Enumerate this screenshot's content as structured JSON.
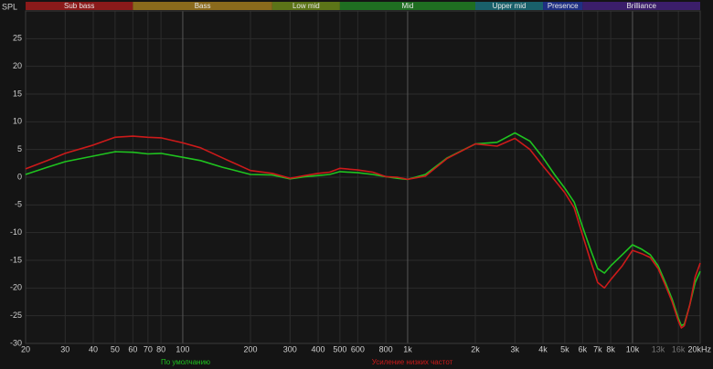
{
  "chart_data": {
    "type": "line",
    "y_axis_label": "SPL",
    "x_scale": "log",
    "x_range": [
      20,
      20000
    ],
    "y_range": [
      -30,
      30
    ],
    "grid": true,
    "bands": [
      {
        "label": "Sub bass",
        "from": 20,
        "to": 60,
        "color": "#8b1a1a"
      },
      {
        "label": "Bass",
        "from": 60,
        "to": 250,
        "color": "#8a6a1c"
      },
      {
        "label": "Low mid",
        "from": 250,
        "to": 500,
        "color": "#5c7418"
      },
      {
        "label": "Mid",
        "from": 500,
        "to": 2000,
        "color": "#1f6e21"
      },
      {
        "label": "Upper mid",
        "from": 2000,
        "to": 4000,
        "color": "#19606a"
      },
      {
        "label": "Presence",
        "from": 4000,
        "to": 6000,
        "color": "#1f2f82"
      },
      {
        "label": "Brilliance",
        "from": 6000,
        "to": 20000,
        "color": "#3b1e6a"
      }
    ],
    "x_ticks": [
      {
        "value": 20,
        "label": "20"
      },
      {
        "value": 30,
        "label": "30"
      },
      {
        "value": 40,
        "label": "40"
      },
      {
        "value": 50,
        "label": "50"
      },
      {
        "value": 60,
        "label": "60"
      },
      {
        "value": 70,
        "label": "70"
      },
      {
        "value": 80,
        "label": "80"
      },
      {
        "value": 100,
        "label": "100"
      },
      {
        "value": 200,
        "label": "200"
      },
      {
        "value": 300,
        "label": "300"
      },
      {
        "value": 400,
        "label": "400"
      },
      {
        "value": 500,
        "label": "500"
      },
      {
        "value": 600,
        "label": "600"
      },
      {
        "value": 800,
        "label": "800"
      },
      {
        "value": 1000,
        "label": "1k"
      },
      {
        "value": 2000,
        "label": "2k"
      },
      {
        "value": 3000,
        "label": "3k"
      },
      {
        "value": 4000,
        "label": "4k"
      },
      {
        "value": 5000,
        "label": "5k"
      },
      {
        "value": 6000,
        "label": "6k"
      },
      {
        "value": 7000,
        "label": "7k"
      },
      {
        "value": 8000,
        "label": "8k"
      },
      {
        "value": 10000,
        "label": "10k"
      },
      {
        "value": 13000,
        "label": "13k"
      },
      {
        "value": 16000,
        "label": "16k"
      },
      {
        "value": 20000,
        "label": "20kHz"
      }
    ],
    "dim_tick_values": [
      13000,
      16000
    ],
    "major_gridlines": [
      100,
      1000,
      10000
    ],
    "y_ticks": [
      25,
      20,
      15,
      10,
      5,
      0,
      -5,
      -10,
      -15,
      -20,
      -25,
      -30
    ],
    "series": [
      {
        "name": "По умолчанию",
        "color": "#1fc31f",
        "points": [
          [
            20,
            0.5
          ],
          [
            25,
            1.8
          ],
          [
            30,
            2.8
          ],
          [
            40,
            3.8
          ],
          [
            50,
            4.6
          ],
          [
            60,
            4.5
          ],
          [
            70,
            4.2
          ],
          [
            80,
            4.3
          ],
          [
            100,
            3.6
          ],
          [
            120,
            3.0
          ],
          [
            150,
            1.8
          ],
          [
            200,
            0.5
          ],
          [
            250,
            0.4
          ],
          [
            300,
            -0.3
          ],
          [
            350,
            0.1
          ],
          [
            400,
            0.3
          ],
          [
            450,
            0.5
          ],
          [
            500,
            1.0
          ],
          [
            600,
            0.8
          ],
          [
            700,
            0.5
          ],
          [
            800,
            0.1
          ],
          [
            900,
            -0.2
          ],
          [
            1000,
            -0.4
          ],
          [
            1200,
            0.5
          ],
          [
            1500,
            3.5
          ],
          [
            2000,
            6.0
          ],
          [
            2500,
            6.3
          ],
          [
            3000,
            8.0
          ],
          [
            3500,
            6.5
          ],
          [
            4000,
            3.5
          ],
          [
            4500,
            0.5
          ],
          [
            5000,
            -2.0
          ],
          [
            5500,
            -4.5
          ],
          [
            6000,
            -9.0
          ],
          [
            6500,
            -13.0
          ],
          [
            7000,
            -16.5
          ],
          [
            7500,
            -17.3
          ],
          [
            8000,
            -16.0
          ],
          [
            9000,
            -14.0
          ],
          [
            10000,
            -12.2
          ],
          [
            11000,
            -13.0
          ],
          [
            12000,
            -14.0
          ],
          [
            13000,
            -16.0
          ],
          [
            14000,
            -19.0
          ],
          [
            15000,
            -22.0
          ],
          [
            16000,
            -25.5
          ],
          [
            16500,
            -26.8
          ],
          [
            17000,
            -26.5
          ],
          [
            18000,
            -23.0
          ],
          [
            19000,
            -19.0
          ],
          [
            20000,
            -17.0
          ]
        ]
      },
      {
        "name": "Усиление низких частот",
        "color": "#cc1a1a",
        "points": [
          [
            20,
            1.5
          ],
          [
            25,
            3.0
          ],
          [
            30,
            4.3
          ],
          [
            40,
            5.8
          ],
          [
            50,
            7.2
          ],
          [
            60,
            7.4
          ],
          [
            70,
            7.2
          ],
          [
            80,
            7.1
          ],
          [
            100,
            6.2
          ],
          [
            120,
            5.3
          ],
          [
            150,
            3.5
          ],
          [
            200,
            1.2
          ],
          [
            250,
            0.7
          ],
          [
            300,
            -0.2
          ],
          [
            350,
            0.3
          ],
          [
            400,
            0.7
          ],
          [
            450,
            0.9
          ],
          [
            500,
            1.6
          ],
          [
            600,
            1.3
          ],
          [
            700,
            0.9
          ],
          [
            800,
            0.1
          ],
          [
            900,
            0.0
          ],
          [
            1000,
            -0.4
          ],
          [
            1200,
            0.2
          ],
          [
            1500,
            3.4
          ],
          [
            2000,
            6.0
          ],
          [
            2500,
            5.6
          ],
          [
            3000,
            7.0
          ],
          [
            3500,
            5.0
          ],
          [
            4000,
            2.0
          ],
          [
            4500,
            -0.5
          ],
          [
            5000,
            -2.8
          ],
          [
            5500,
            -5.5
          ],
          [
            6000,
            -10.5
          ],
          [
            6500,
            -15.0
          ],
          [
            7000,
            -19.0
          ],
          [
            7500,
            -20.0
          ],
          [
            8000,
            -18.5
          ],
          [
            9000,
            -16.0
          ],
          [
            10000,
            -13.2
          ],
          [
            11000,
            -13.8
          ],
          [
            12000,
            -14.5
          ],
          [
            13000,
            -16.5
          ],
          [
            14000,
            -19.5
          ],
          [
            15000,
            -22.5
          ],
          [
            16000,
            -26.0
          ],
          [
            16500,
            -27.2
          ],
          [
            17000,
            -26.8
          ],
          [
            18000,
            -23.0
          ],
          [
            19000,
            -18.0
          ],
          [
            20000,
            -15.5
          ]
        ]
      }
    ]
  }
}
